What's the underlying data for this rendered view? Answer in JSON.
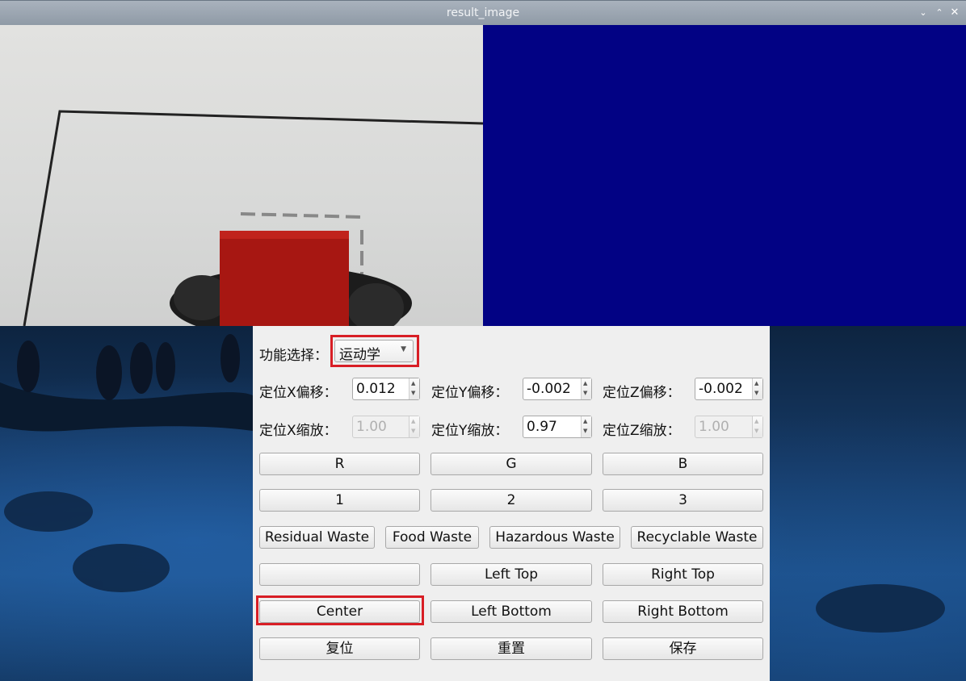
{
  "window": {
    "title": "result_image"
  },
  "panel": {
    "function_select": {
      "label": "功能选择：",
      "value": "运动学"
    },
    "offsets": [
      {
        "label": "定位X偏移：",
        "value": "0.012",
        "disabled": false
      },
      {
        "label": "定位Y偏移：",
        "value": "-0.002",
        "disabled": false
      },
      {
        "label": "定位Z偏移：",
        "value": "-0.002",
        "disabled": false
      }
    ],
    "scales": [
      {
        "label": "定位X缩放：",
        "value": "1.00",
        "disabled": true
      },
      {
        "label": "定位Y缩放：",
        "value": "0.97",
        "disabled": false
      },
      {
        "label": "定位Z缩放：",
        "value": "1.00",
        "disabled": true
      }
    ],
    "color_buttons": [
      "R",
      "G",
      "B"
    ],
    "number_buttons": [
      "1",
      "2",
      "3"
    ],
    "waste_buttons": [
      "Residual Waste",
      "Food Waste",
      "Hazardous Waste",
      "Recyclable Waste"
    ],
    "position_buttons_row1": [
      "",
      "Left Top",
      "Right Top"
    ],
    "position_buttons_row2": [
      "Center",
      "Left Bottom",
      "Right Bottom"
    ],
    "action_buttons": [
      "复位",
      "重置",
      "保存"
    ]
  },
  "colors": {
    "blue_pane": "#020284",
    "highlight": "#d81e25"
  }
}
